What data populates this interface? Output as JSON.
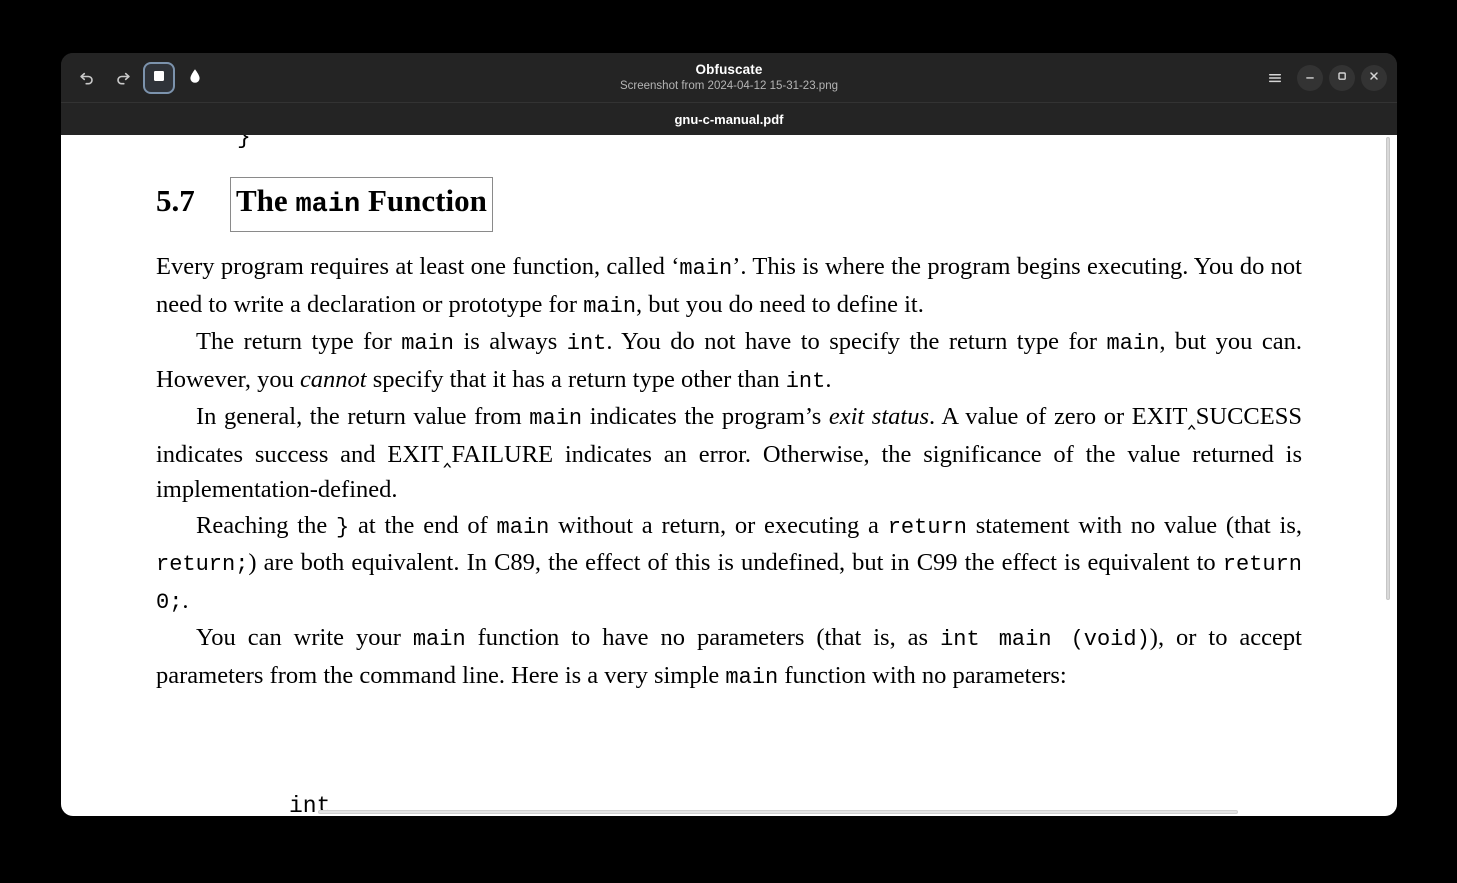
{
  "window": {
    "title": "Obfuscate",
    "subtitle": "Screenshot from 2024-04-12 15-31-23.png",
    "document_name": "gnu-c-manual.pdf",
    "accent_selected": "#7c93ad",
    "header_bg": "#242424",
    "canvas_bg": "#ffffff"
  },
  "toolbar": {
    "undo_label": "Undo",
    "redo_label": "Redo",
    "box_tool_label": "Box",
    "blur_tool_label": "Blur",
    "selected_tool": "Box"
  },
  "window_controls": {
    "menu_label": "Main Menu",
    "minimize_label": "Minimize",
    "maximize_label": "Maximize",
    "close_label": "Close"
  },
  "document": {
    "prev_code_fragment": "}",
    "section_number": "5.7",
    "section_title_plain_1": "The ",
    "section_title_mono": "main",
    "section_title_plain_2": " Function",
    "paragraphs": [
      {
        "id": "p1",
        "runs": [
          {
            "t": "Every program requires at least one function, called ‘",
            "s": "normal"
          },
          {
            "t": "main",
            "s": "mono"
          },
          {
            "t": "’. This is where the program begins executing. You do not need to write a declaration or prototype for ",
            "s": "normal"
          },
          {
            "t": "main",
            "s": "mono"
          },
          {
            "t": ", but you do need to define it.",
            "s": "normal"
          }
        ]
      },
      {
        "id": "p2",
        "runs": [
          {
            "t": "The return type for ",
            "s": "normal"
          },
          {
            "t": "main",
            "s": "mono"
          },
          {
            "t": " is always ",
            "s": "normal"
          },
          {
            "t": "int",
            "s": "mono"
          },
          {
            "t": ". You do not have to specify the return type for ",
            "s": "normal"
          },
          {
            "t": "main",
            "s": "mono"
          },
          {
            "t": ", but you can. However, you ",
            "s": "normal"
          },
          {
            "t": "cannot",
            "s": "italic"
          },
          {
            "t": " specify that it has a return type other than ",
            "s": "normal"
          },
          {
            "t": "int",
            "s": "mono"
          },
          {
            "t": ".",
            "s": "normal"
          }
        ]
      },
      {
        "id": "p3",
        "runs": [
          {
            "t": "In general, the return value from ",
            "s": "normal"
          },
          {
            "t": "main",
            "s": "mono"
          },
          {
            "t": " indicates the program’s ",
            "s": "normal"
          },
          {
            "t": "exit status",
            "s": "italic"
          },
          {
            "t": ". A value of zero or EXIT‸SUCCESS indicates success and EXIT‸FAILURE indicates an error. Otherwise, the significance of the value returned is implementation-defined.",
            "s": "normal"
          }
        ]
      },
      {
        "id": "p4",
        "runs": [
          {
            "t": "Reaching the ",
            "s": "normal"
          },
          {
            "t": "}",
            "s": "mono"
          },
          {
            "t": " at the end of ",
            "s": "normal"
          },
          {
            "t": "main",
            "s": "mono"
          },
          {
            "t": " without a return, or executing a ",
            "s": "normal"
          },
          {
            "t": "return",
            "s": "mono"
          },
          {
            "t": " statement with no value (that is, ",
            "s": "normal"
          },
          {
            "t": "return;",
            "s": "mono"
          },
          {
            "t": ") are both equivalent. In C89, the effect of this is undefined, but in C99 the effect is equivalent to ",
            "s": "normal"
          },
          {
            "t": "return 0;",
            "s": "mono"
          },
          {
            "t": ".",
            "s": "normal"
          }
        ]
      },
      {
        "id": "p5",
        "runs": [
          {
            "t": "You can write your ",
            "s": "normal"
          },
          {
            "t": "main",
            "s": "mono"
          },
          {
            "t": " function to have no parameters (that is, as ",
            "s": "normal"
          },
          {
            "t": "int main (void)",
            "s": "mono"
          },
          {
            "t": "), or to accept parameters from the command line. Here is a very simple ",
            "s": "normal"
          },
          {
            "t": "main",
            "s": "mono"
          },
          {
            "t": " function with no parameters:",
            "s": "normal"
          }
        ]
      }
    ],
    "code_fragment_bottom": "int"
  },
  "selection": {
    "label": "selection-rectangle",
    "border_color": "#8a8a8a"
  }
}
